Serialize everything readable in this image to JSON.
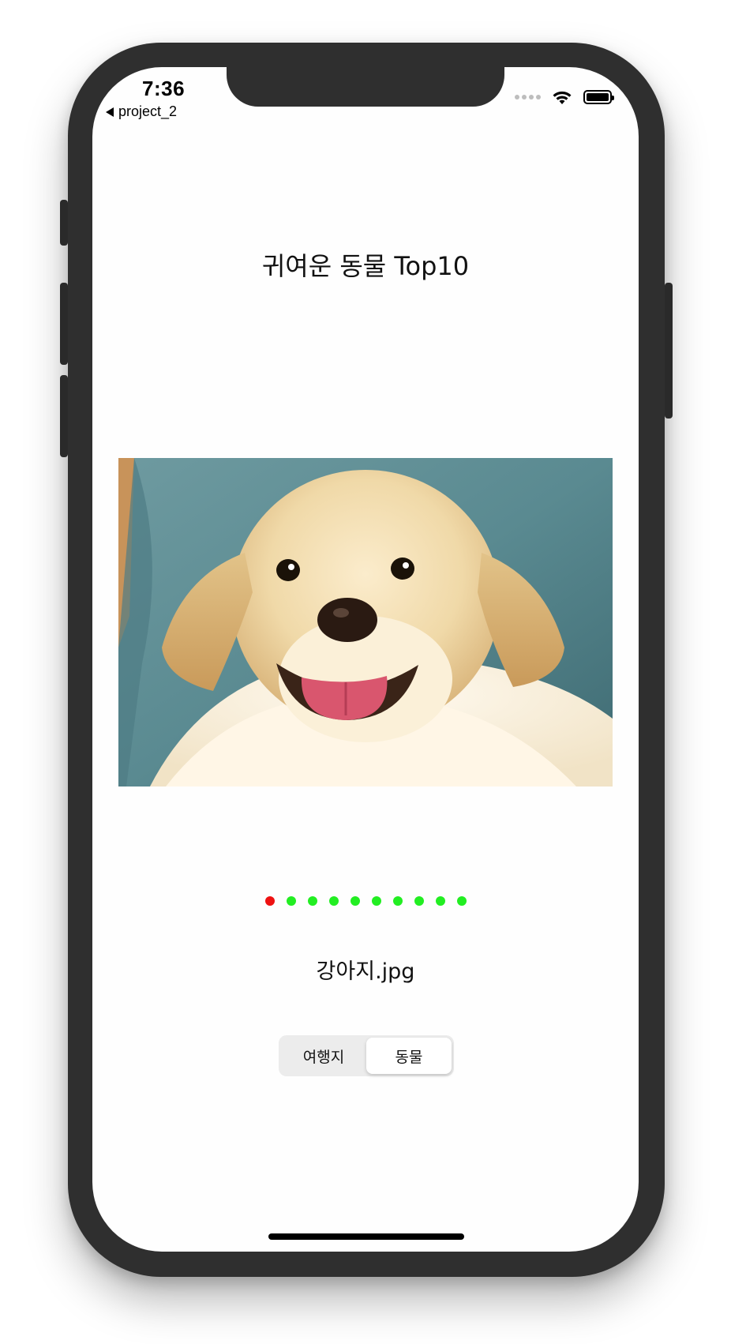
{
  "status_bar": {
    "time": "7:36",
    "back_label": "project_2"
  },
  "main": {
    "title": "귀여운 동물 Top10",
    "filename": "강아지.jpg",
    "page_dots": {
      "count": 10,
      "current_index": 0,
      "active_color": "#ee1111",
      "inactive_color": "#22ee22"
    }
  },
  "segmented_control": {
    "options": [
      "여행지",
      "동물"
    ],
    "selected_index": 1
  },
  "icons": {
    "back": "back-arrow-icon",
    "signal": "cellular-signal-icon",
    "wifi": "wifi-icon",
    "battery": "battery-icon"
  }
}
